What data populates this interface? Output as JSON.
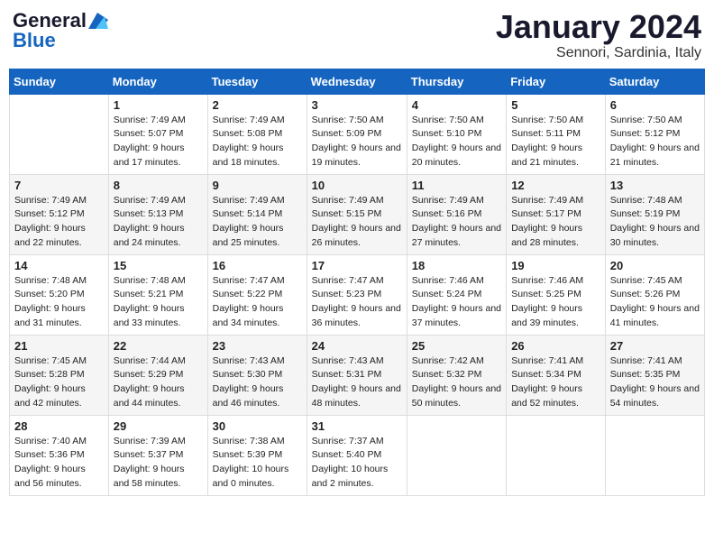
{
  "logo": {
    "line1": "General",
    "line2": "Blue"
  },
  "title": {
    "month": "January 2024",
    "location": "Sennori, Sardinia, Italy"
  },
  "headers": [
    "Sunday",
    "Monday",
    "Tuesday",
    "Wednesday",
    "Thursday",
    "Friday",
    "Saturday"
  ],
  "weeks": [
    [
      {
        "day": "",
        "sunrise": "",
        "sunset": "",
        "daylight": ""
      },
      {
        "day": "1",
        "sunrise": "Sunrise: 7:49 AM",
        "sunset": "Sunset: 5:07 PM",
        "daylight": "Daylight: 9 hours and 17 minutes."
      },
      {
        "day": "2",
        "sunrise": "Sunrise: 7:49 AM",
        "sunset": "Sunset: 5:08 PM",
        "daylight": "Daylight: 9 hours and 18 minutes."
      },
      {
        "day": "3",
        "sunrise": "Sunrise: 7:50 AM",
        "sunset": "Sunset: 5:09 PM",
        "daylight": "Daylight: 9 hours and 19 minutes."
      },
      {
        "day": "4",
        "sunrise": "Sunrise: 7:50 AM",
        "sunset": "Sunset: 5:10 PM",
        "daylight": "Daylight: 9 hours and 20 minutes."
      },
      {
        "day": "5",
        "sunrise": "Sunrise: 7:50 AM",
        "sunset": "Sunset: 5:11 PM",
        "daylight": "Daylight: 9 hours and 21 minutes."
      },
      {
        "day": "6",
        "sunrise": "Sunrise: 7:50 AM",
        "sunset": "Sunset: 5:12 PM",
        "daylight": "Daylight: 9 hours and 21 minutes."
      }
    ],
    [
      {
        "day": "7",
        "sunrise": "Sunrise: 7:49 AM",
        "sunset": "Sunset: 5:12 PM",
        "daylight": "Daylight: 9 hours and 22 minutes."
      },
      {
        "day": "8",
        "sunrise": "Sunrise: 7:49 AM",
        "sunset": "Sunset: 5:13 PM",
        "daylight": "Daylight: 9 hours and 24 minutes."
      },
      {
        "day": "9",
        "sunrise": "Sunrise: 7:49 AM",
        "sunset": "Sunset: 5:14 PM",
        "daylight": "Daylight: 9 hours and 25 minutes."
      },
      {
        "day": "10",
        "sunrise": "Sunrise: 7:49 AM",
        "sunset": "Sunset: 5:15 PM",
        "daylight": "Daylight: 9 hours and 26 minutes."
      },
      {
        "day": "11",
        "sunrise": "Sunrise: 7:49 AM",
        "sunset": "Sunset: 5:16 PM",
        "daylight": "Daylight: 9 hours and 27 minutes."
      },
      {
        "day": "12",
        "sunrise": "Sunrise: 7:49 AM",
        "sunset": "Sunset: 5:17 PM",
        "daylight": "Daylight: 9 hours and 28 minutes."
      },
      {
        "day": "13",
        "sunrise": "Sunrise: 7:48 AM",
        "sunset": "Sunset: 5:19 PM",
        "daylight": "Daylight: 9 hours and 30 minutes."
      }
    ],
    [
      {
        "day": "14",
        "sunrise": "Sunrise: 7:48 AM",
        "sunset": "Sunset: 5:20 PM",
        "daylight": "Daylight: 9 hours and 31 minutes."
      },
      {
        "day": "15",
        "sunrise": "Sunrise: 7:48 AM",
        "sunset": "Sunset: 5:21 PM",
        "daylight": "Daylight: 9 hours and 33 minutes."
      },
      {
        "day": "16",
        "sunrise": "Sunrise: 7:47 AM",
        "sunset": "Sunset: 5:22 PM",
        "daylight": "Daylight: 9 hours and 34 minutes."
      },
      {
        "day": "17",
        "sunrise": "Sunrise: 7:47 AM",
        "sunset": "Sunset: 5:23 PM",
        "daylight": "Daylight: 9 hours and 36 minutes."
      },
      {
        "day": "18",
        "sunrise": "Sunrise: 7:46 AM",
        "sunset": "Sunset: 5:24 PM",
        "daylight": "Daylight: 9 hours and 37 minutes."
      },
      {
        "day": "19",
        "sunrise": "Sunrise: 7:46 AM",
        "sunset": "Sunset: 5:25 PM",
        "daylight": "Daylight: 9 hours and 39 minutes."
      },
      {
        "day": "20",
        "sunrise": "Sunrise: 7:45 AM",
        "sunset": "Sunset: 5:26 PM",
        "daylight": "Daylight: 9 hours and 41 minutes."
      }
    ],
    [
      {
        "day": "21",
        "sunrise": "Sunrise: 7:45 AM",
        "sunset": "Sunset: 5:28 PM",
        "daylight": "Daylight: 9 hours and 42 minutes."
      },
      {
        "day": "22",
        "sunrise": "Sunrise: 7:44 AM",
        "sunset": "Sunset: 5:29 PM",
        "daylight": "Daylight: 9 hours and 44 minutes."
      },
      {
        "day": "23",
        "sunrise": "Sunrise: 7:43 AM",
        "sunset": "Sunset: 5:30 PM",
        "daylight": "Daylight: 9 hours and 46 minutes."
      },
      {
        "day": "24",
        "sunrise": "Sunrise: 7:43 AM",
        "sunset": "Sunset: 5:31 PM",
        "daylight": "Daylight: 9 hours and 48 minutes."
      },
      {
        "day": "25",
        "sunrise": "Sunrise: 7:42 AM",
        "sunset": "Sunset: 5:32 PM",
        "daylight": "Daylight: 9 hours and 50 minutes."
      },
      {
        "day": "26",
        "sunrise": "Sunrise: 7:41 AM",
        "sunset": "Sunset: 5:34 PM",
        "daylight": "Daylight: 9 hours and 52 minutes."
      },
      {
        "day": "27",
        "sunrise": "Sunrise: 7:41 AM",
        "sunset": "Sunset: 5:35 PM",
        "daylight": "Daylight: 9 hours and 54 minutes."
      }
    ],
    [
      {
        "day": "28",
        "sunrise": "Sunrise: 7:40 AM",
        "sunset": "Sunset: 5:36 PM",
        "daylight": "Daylight: 9 hours and 56 minutes."
      },
      {
        "day": "29",
        "sunrise": "Sunrise: 7:39 AM",
        "sunset": "Sunset: 5:37 PM",
        "daylight": "Daylight: 9 hours and 58 minutes."
      },
      {
        "day": "30",
        "sunrise": "Sunrise: 7:38 AM",
        "sunset": "Sunset: 5:39 PM",
        "daylight": "Daylight: 10 hours and 0 minutes."
      },
      {
        "day": "31",
        "sunrise": "Sunrise: 7:37 AM",
        "sunset": "Sunset: 5:40 PM",
        "daylight": "Daylight: 10 hours and 2 minutes."
      },
      {
        "day": "",
        "sunrise": "",
        "sunset": "",
        "daylight": ""
      },
      {
        "day": "",
        "sunrise": "",
        "sunset": "",
        "daylight": ""
      },
      {
        "day": "",
        "sunrise": "",
        "sunset": "",
        "daylight": ""
      }
    ]
  ]
}
